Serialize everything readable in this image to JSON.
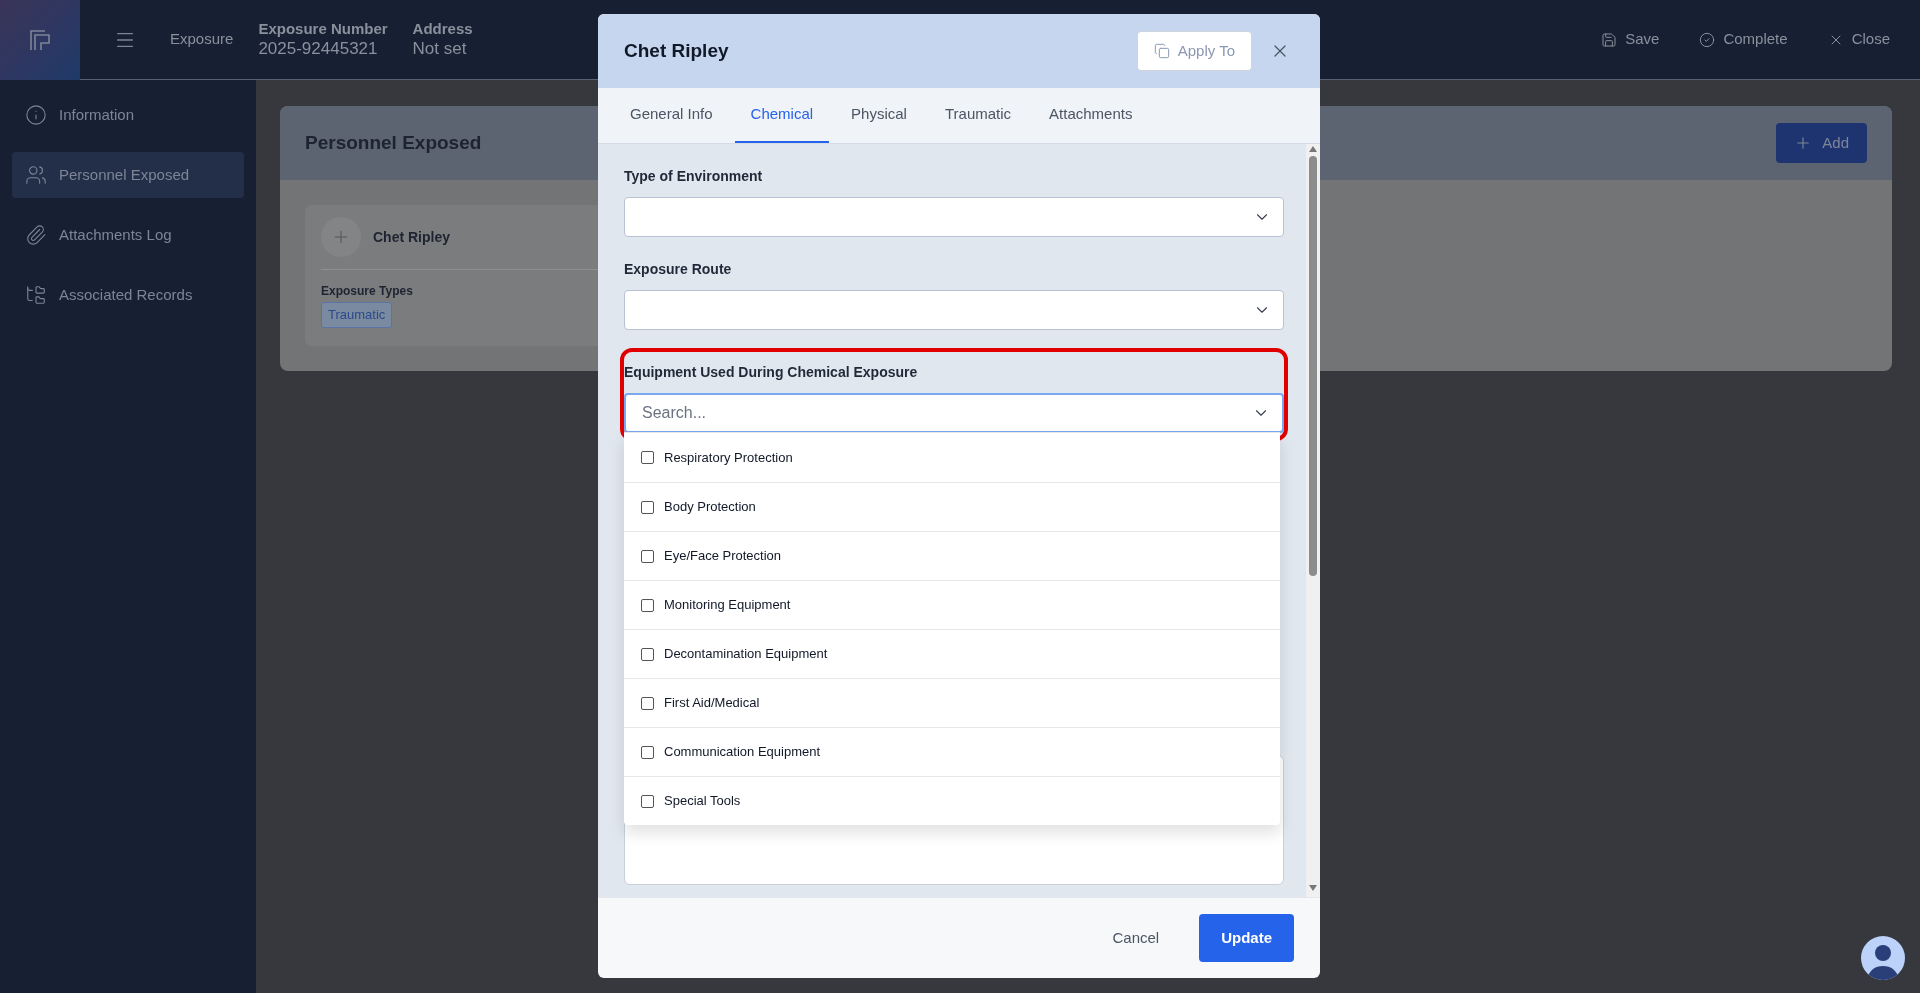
{
  "header": {
    "module": "Exposure",
    "fields": [
      {
        "label": "Exposure Number",
        "value": "2025-92445321"
      },
      {
        "label": "Address",
        "value": "Not set"
      }
    ],
    "actions": [
      {
        "kind": "save",
        "label": "Save"
      },
      {
        "kind": "complete",
        "label": "Complete"
      },
      {
        "kind": "close",
        "label": "Close"
      }
    ]
  },
  "sidebar": {
    "items": [
      {
        "kind": "info",
        "label": "Information",
        "selected": false
      },
      {
        "kind": "people",
        "label": "Personnel Exposed",
        "selected": true
      },
      {
        "kind": "attach",
        "label": "Attachments Log",
        "selected": false
      },
      {
        "kind": "records",
        "label": "Associated Records",
        "selected": false
      }
    ]
  },
  "panel": {
    "title": "Personnel Exposed",
    "add_button": "Add",
    "person": {
      "name": "Chet Ripley",
      "types_label": "Exposure Types",
      "types": [
        "Traumatic"
      ]
    }
  },
  "modal": {
    "title": "Chet Ripley",
    "apply_button": "Apply To",
    "tabs": [
      {
        "label": "General Info",
        "selected": false
      },
      {
        "label": "Chemical",
        "selected": true
      },
      {
        "label": "Physical",
        "selected": false
      },
      {
        "label": "Traumatic",
        "selected": false
      },
      {
        "label": "Attachments",
        "selected": false
      }
    ],
    "fields": [
      {
        "kind": "select",
        "label": "Type of Environment",
        "highlighted": false
      },
      {
        "kind": "select",
        "label": "Exposure Route",
        "highlighted": false
      },
      {
        "kind": "search",
        "label": "Equipment Used During Chemical Exposure",
        "placeholder": "Search...",
        "highlighted": true
      }
    ],
    "options": [
      {
        "label": "Respiratory Protection",
        "checked": false
      },
      {
        "label": "Body Protection",
        "checked": false
      },
      {
        "label": "Eye/Face Protection",
        "checked": false
      },
      {
        "label": "Monitoring Equipment",
        "checked": false
      },
      {
        "label": "Decontamination Equipment",
        "checked": false
      },
      {
        "label": "First Aid/Medical",
        "checked": false
      },
      {
        "label": "Communication Equipment",
        "checked": false
      },
      {
        "label": "Special Tools",
        "checked": false
      }
    ],
    "cancel_button": "Cancel",
    "update_button": "Update"
  }
}
